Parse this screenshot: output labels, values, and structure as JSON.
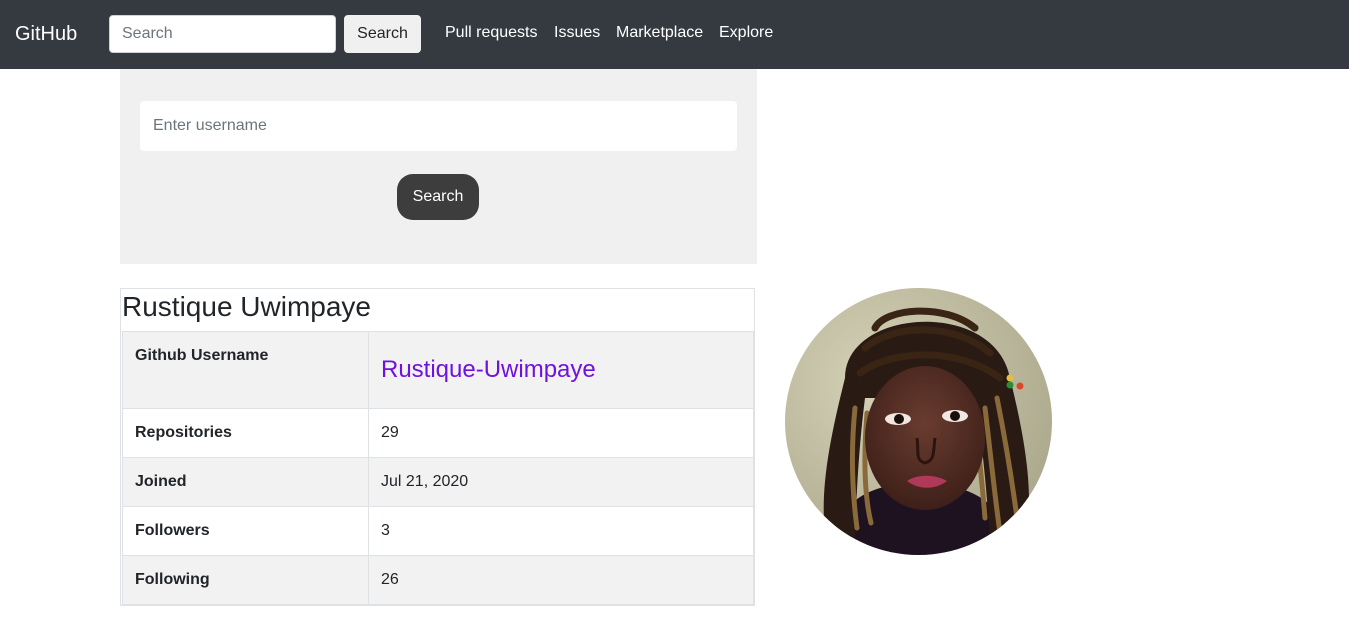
{
  "navbar": {
    "brand": "GitHub",
    "search_placeholder": "Search",
    "search_button": "Search",
    "links": [
      "Pull requests",
      "Issues",
      "Marketplace",
      "Explore"
    ]
  },
  "search_panel": {
    "username_placeholder": "Enter username",
    "search_button": "Search"
  },
  "profile": {
    "name": "Rustique Uwimpaye",
    "rows": [
      {
        "label": "Github Username",
        "value": "Rustique-Uwimpaye"
      },
      {
        "label": "Repositories",
        "value": "29"
      },
      {
        "label": "Joined",
        "value": "Jul 21, 2020"
      },
      {
        "label": "Followers",
        "value": "3"
      },
      {
        "label": "Following",
        "value": "26"
      }
    ]
  },
  "colors": {
    "navbar_bg": "#343a40",
    "link_purple": "#6f12e0",
    "panel_bg": "#f0f0f0",
    "button_dark": "#3d3d3d"
  }
}
